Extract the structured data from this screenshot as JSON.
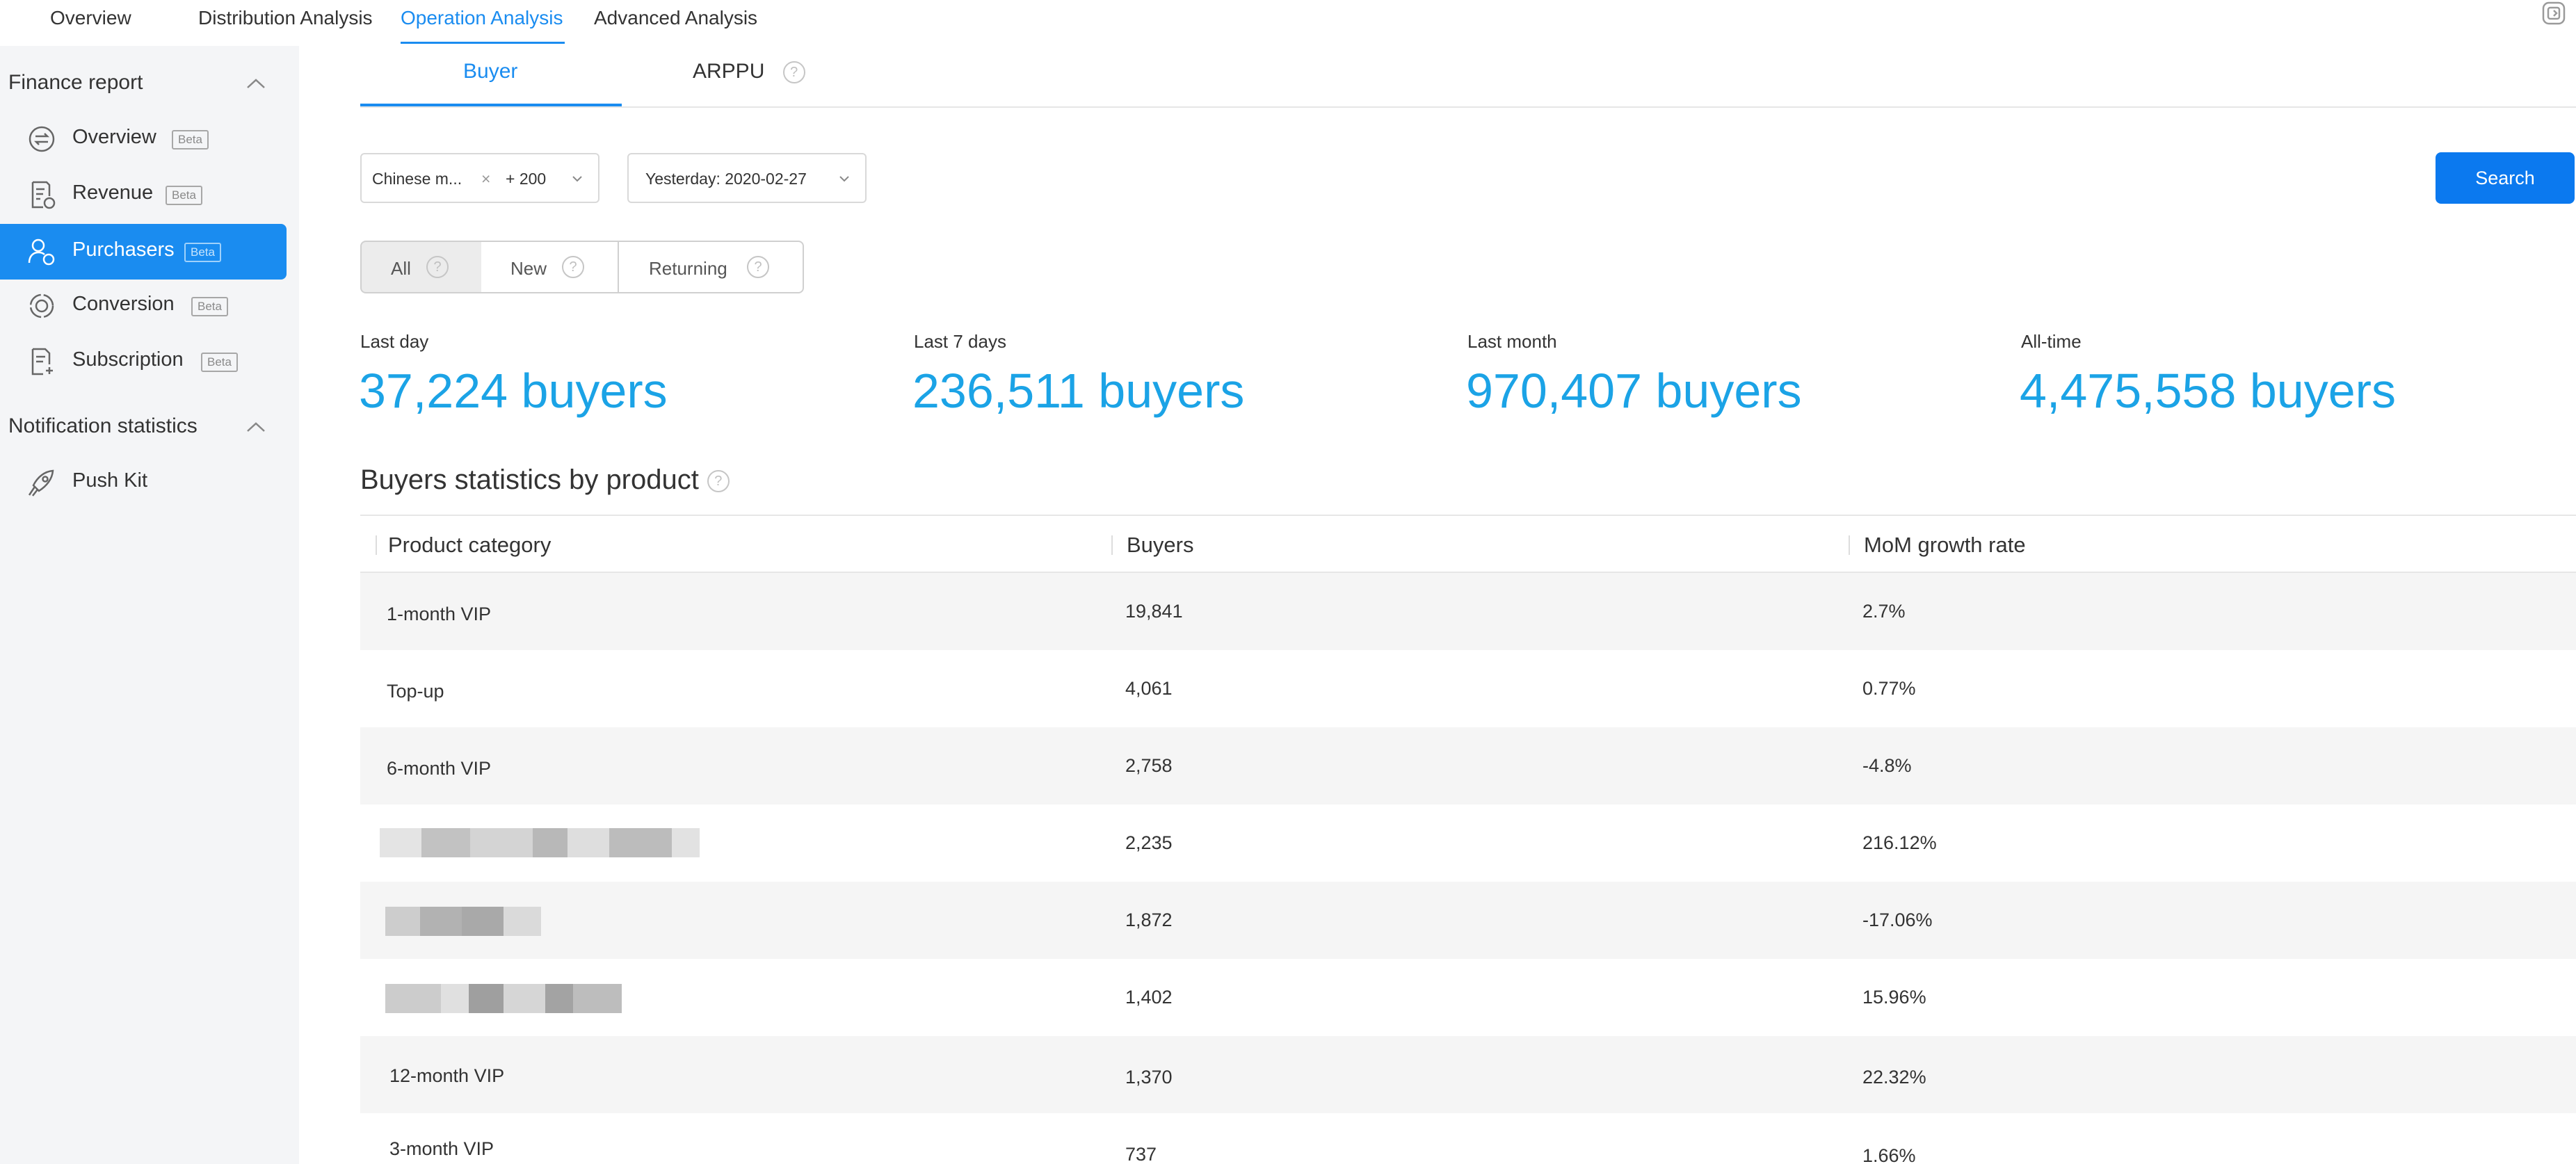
{
  "nav": {
    "tabs": [
      {
        "label": "Overview"
      },
      {
        "label": "Distribution Analysis"
      },
      {
        "label": "Operation Analysis"
      },
      {
        "label": "Advanced Analysis"
      }
    ],
    "active_tab": "Operation Analysis"
  },
  "sidebar": {
    "finance_group": "Finance report",
    "items": [
      {
        "label": "Overview",
        "badge": "Beta"
      },
      {
        "label": "Revenue",
        "badge": "Beta"
      },
      {
        "label": "Purchasers",
        "badge": "Beta"
      },
      {
        "label": "Conversion",
        "badge": "Beta"
      },
      {
        "label": "Subscription",
        "badge": "Beta"
      }
    ],
    "active_item": "Purchasers",
    "notification_group": "Notification statistics",
    "push_kit": "Push Kit"
  },
  "subtabs": {
    "buyer": "Buyer",
    "arppu": "ARPPU",
    "help": "?"
  },
  "filters": {
    "country_value": "Chinese m...",
    "country_remove": "×",
    "country_more": "+ 200",
    "date_value": "Yesterday: 2020-02-27",
    "search_label": "Search"
  },
  "segments": {
    "all": "All",
    "new": "New",
    "returning": "Returning",
    "help": "?"
  },
  "stats": [
    {
      "label": "Last day",
      "value": "37,224 buyers"
    },
    {
      "label": "Last 7 days",
      "value": "236,511 buyers"
    },
    {
      "label": "Last month",
      "value": "970,407 buyers"
    },
    {
      "label": "All-time",
      "value": "4,475,558 buyers"
    }
  ],
  "table": {
    "title": "Buyers statistics by product",
    "help": "?",
    "columns": [
      "Product category",
      "Buyers",
      "MoM growth rate"
    ],
    "rows": [
      {
        "product": "1-month VIP",
        "buyers": "19,841",
        "growth": "2.7%"
      },
      {
        "product": "Top-up",
        "buyers": "4,061",
        "growth": "0.77%"
      },
      {
        "product": "6-month VIP",
        "buyers": "2,758",
        "growth": "-4.8%"
      },
      {
        "product": "",
        "buyers": "2,235",
        "growth": "216.12%"
      },
      {
        "product": "",
        "buyers": "1,872",
        "growth": "-17.06%"
      },
      {
        "product": "",
        "buyers": "1,402",
        "growth": "15.96%"
      },
      {
        "product": "12-month VIP",
        "buyers": "1,370",
        "growth": "22.32%"
      },
      {
        "product": "3-month VIP",
        "buyers": "737",
        "growth": "1.66%"
      }
    ]
  },
  "colors": {
    "accent": "#1a8cf0",
    "stat_value": "#1ba3e6",
    "sidebar_bg": "#f4f5f7",
    "row_alt": "#f5f5f5"
  }
}
